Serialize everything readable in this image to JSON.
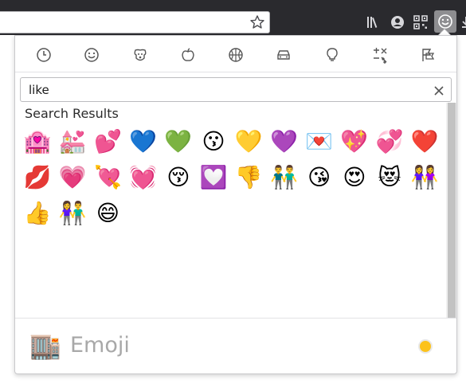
{
  "toolbar": {
    "icons": [
      "star-icon",
      "library-icon",
      "account-icon",
      "qr-code-icon",
      "emoji-icon",
      "download-icon"
    ]
  },
  "categories": [
    {
      "name": "recent",
      "icon": "clock-icon"
    },
    {
      "name": "smileys",
      "icon": "smiley-icon"
    },
    {
      "name": "animals",
      "icon": "dog-icon"
    },
    {
      "name": "food",
      "icon": "apple-icon"
    },
    {
      "name": "activities",
      "icon": "ball-icon"
    },
    {
      "name": "travel",
      "icon": "car-icon"
    },
    {
      "name": "objects",
      "icon": "lightbulb-icon"
    },
    {
      "name": "symbols",
      "icon": "symbols-icon"
    },
    {
      "name": "flags",
      "icon": "flag-icon"
    }
  ],
  "search": {
    "value": "like"
  },
  "results": {
    "title": "Search Results",
    "emojis": [
      "🏩",
      "💒",
      "💕",
      "💙",
      "💚",
      "😗",
      "💛",
      "💜",
      "💌",
      "💖",
      "💞",
      "❤️",
      "💋",
      "💗",
      "💘",
      "💓",
      "😚",
      "💟",
      "👎",
      "👬",
      "😘",
      "😍",
      "😻",
      "👭",
      "👍",
      "👫",
      "😄"
    ]
  },
  "footer": {
    "preview_emoji": "🏬",
    "label": "Emoji",
    "tone_color": "#fcc21b"
  },
  "colors": {
    "toolbar_bg": "#2a2a2e",
    "icon_gray": "#555555"
  }
}
